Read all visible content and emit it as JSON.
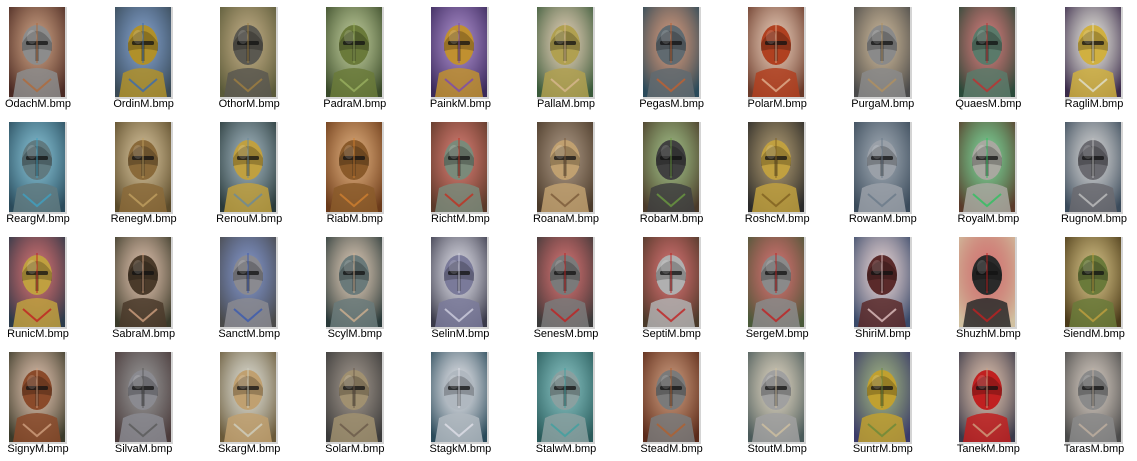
{
  "files": [
    {
      "name": "OdachM.bmp",
      "icon": "portrait-knight-horned-helm",
      "bg": "#4a2a24",
      "helm": "#8c8c8c",
      "accent": "#b06a3a"
    },
    {
      "name": "OrdinM.bmp",
      "icon": "portrait-blue-faced-warrior",
      "bg": "#3a4a55",
      "helm": "#b0902a",
      "accent": "#3a6ab0"
    },
    {
      "name": "OthorM.bmp",
      "icon": "portrait-dark-helm-knight",
      "bg": "#5a5a3a",
      "helm": "#5a5850",
      "accent": "#a08040"
    },
    {
      "name": "PadraM.bmp",
      "icon": "portrait-treant-druid",
      "bg": "#3a4a2a",
      "helm": "#6a7a3a",
      "accent": "#9ab060"
    },
    {
      "name": "PainkM.bmp",
      "icon": "portrait-gold-visor-knight",
      "bg": "#3a2a5a",
      "helm": "#c09030",
      "accent": "#7a4ab0"
    },
    {
      "name": "PallaM.bmp",
      "icon": "portrait-female-paladin",
      "bg": "#3a5a3a",
      "helm": "#b0a050",
      "accent": "#d8b890"
    },
    {
      "name": "PegasM.bmp",
      "icon": "portrait-pegasus-knight",
      "bg": "#2a4a5a",
      "helm": "#606a70",
      "accent": "#c06030"
    },
    {
      "name": "PolarM.bmp",
      "icon": "portrait-red-haired-warrior",
      "bg": "#6a3a2a",
      "helm": "#b04020",
      "accent": "#e0b090"
    },
    {
      "name": "PurgaM.bmp",
      "icon": "portrait-chainmail-knight",
      "bg": "#4a4a4a",
      "helm": "#8a8a8a",
      "accent": "#b09060"
    },
    {
      "name": "QuaesM.bmp",
      "icon": "portrait-green-helm-knight",
      "bg": "#2a4a3a",
      "helm": "#5a7a6a",
      "accent": "#c03030"
    },
    {
      "name": "RagliM.bmp",
      "icon": "portrait-golden-knight",
      "bg": "#3a2a4a",
      "helm": "#d0b040",
      "accent": "#e0e0d0"
    },
    {
      "name": "ReargM.bmp",
      "icon": "portrait-blue-armored-knight",
      "bg": "#2a4a5a",
      "helm": "#607a80",
      "accent": "#40a0c0"
    },
    {
      "name": "RenegM.bmp",
      "icon": "portrait-horned-beast",
      "bg": "#5a4a2a",
      "helm": "#8a6a3a",
      "accent": "#c0a060"
    },
    {
      "name": "RenouM.bmp",
      "icon": "portrait-crowned-king",
      "bg": "#2a3a3a",
      "helm": "#c0a040",
      "accent": "#6a8a9a"
    },
    {
      "name": "RiabM.bmp",
      "icon": "portrait-wooden-warrior",
      "bg": "#6a3a1a",
      "helm": "#8a5a2a",
      "accent": "#d08030"
    },
    {
      "name": "RichtM.bmp",
      "icon": "portrait-red-plumed-knight",
      "bg": "#5a3a2a",
      "helm": "#7a8a7a",
      "accent": "#c03020"
    },
    {
      "name": "RoanaM.bmp",
      "icon": "portrait-elf-archer",
      "bg": "#4a3a2a",
      "helm": "#c0a070",
      "accent": "#7a5a3a"
    },
    {
      "name": "RobarM.bmp",
      "icon": "portrait-green-goblin",
      "bg": "#4a3a2a",
      "helm": "#404040",
      "accent": "#6a9a40"
    },
    {
      "name": "RoshcM.bmp",
      "icon": "portrait-spiked-gold-helm",
      "bg": "#2a2a2a",
      "helm": "#c0a040",
      "accent": "#806020"
    },
    {
      "name": "RowanM.bmp",
      "icon": "portrait-steel-helm-knight",
      "bg": "#3a4a5a",
      "helm": "#9aa0a8",
      "accent": "#6a7a8a"
    },
    {
      "name": "RoyalM.bmp",
      "icon": "portrait-emerald-eyed-knight",
      "bg": "#5a3a2a",
      "helm": "#a8a8a0",
      "accent": "#30c060"
    },
    {
      "name": "RugnoM.bmp",
      "icon": "portrait-dwarf-king",
      "bg": "#3a4a5a",
      "helm": "#6a6a70",
      "accent": "#c0c0c0"
    },
    {
      "name": "RunicM.bmp",
      "icon": "portrait-runic-gold-helm",
      "bg": "#2a3a4a",
      "helm": "#c0a040",
      "accent": "#c02020"
    },
    {
      "name": "SabraM.bmp",
      "icon": "portrait-dark-haired-woman",
      "bg": "#3a3a2a",
      "helm": "#4a3a2a",
      "accent": "#d0a080"
    },
    {
      "name": "SanctM.bmp",
      "icon": "portrait-horned-barbarian",
      "bg": "#4a4a4a",
      "helm": "#8a8a90",
      "accent": "#3a5ab0"
    },
    {
      "name": "ScylM.bmp",
      "icon": "portrait-valkyrie",
      "bg": "#2a3a3a",
      "helm": "#6a7a7a",
      "accent": "#d0b090"
    },
    {
      "name": "SelinM.bmp",
      "icon": "portrait-hooded-moon-priestess",
      "bg": "#3a3a4a",
      "helm": "#7a7a9a",
      "accent": "#d0d0e0"
    },
    {
      "name": "SenesM.bmp",
      "icon": "portrait-red-crest-knight",
      "bg": "#3a3a3a",
      "helm": "#7a7a7a",
      "accent": "#c02020"
    },
    {
      "name": "SeptiM.bmp",
      "icon": "portrait-crowned-bucket-helm",
      "bg": "#4a3a2a",
      "helm": "#b0b0b0",
      "accent": "#c02020"
    },
    {
      "name": "SergeM.bmp",
      "icon": "portrait-crusader",
      "bg": "#4a5a3a",
      "helm": "#8a8a8a",
      "accent": "#c02020"
    },
    {
      "name": "ShiriM.bmp",
      "icon": "portrait-dark-elf-sorceress",
      "bg": "#3a4a6a",
      "helm": "#5a2a2a",
      "accent": "#e0c0c0"
    },
    {
      "name": "ShuzhM.bmp",
      "icon": "portrait-eastern-empress",
      "bg": "#d0c0a0",
      "helm": "#2a2a2a",
      "accent": "#c02020"
    },
    {
      "name": "SiendM.bmp",
      "icon": "portrait-green-hooded-ranger",
      "bg": "#4a3a1a",
      "helm": "#6a7a3a",
      "accent": "#c0a040"
    },
    {
      "name": "SignyM.bmp",
      "icon": "portrait-red-haired-shieldmaiden",
      "bg": "#3a3a2a",
      "helm": "#8a4a2a",
      "accent": "#d0a080"
    },
    {
      "name": "SilvaM.bmp",
      "icon": "portrait-silver-helm-knight",
      "bg": "#4a3a3a",
      "helm": "#8a8a90",
      "accent": "#5a5a5a"
    },
    {
      "name": "SkargM.bmp",
      "icon": "portrait-ram-horned-elder",
      "bg": "#6a5a3a",
      "helm": "#c0a070",
      "accent": "#d0d0c0"
    },
    {
      "name": "SolarM.bmp",
      "icon": "portrait-sun-helm-knight",
      "bg": "#3a3a3a",
      "helm": "#a09070",
      "accent": "#6a5a4a"
    },
    {
      "name": "StagkM.bmp",
      "icon": "portrait-stag-helm-knight",
      "bg": "#2a4a5a",
      "helm": "#b0b8c0",
      "accent": "#e0e0e8"
    },
    {
      "name": "StalwM.bmp",
      "icon": "portrait-teal-plate-knight",
      "bg": "#2a5a5a",
      "helm": "#8aa0a0",
      "accent": "#40a0a0"
    },
    {
      "name": "SteadM.bmp",
      "icon": "portrait-bronze-helm-knight",
      "bg": "#5a2a1a",
      "helm": "#7a7a7a",
      "accent": "#b06030"
    },
    {
      "name": "StoutM.bmp",
      "icon": "portrait-winged-helm-dwarf",
      "bg": "#4a5a5a",
      "helm": "#a0a0a0",
      "accent": "#d0c0a0"
    },
    {
      "name": "SuntrM.bmp",
      "icon": "portrait-sunflower-dryad",
      "bg": "#3a3a6a",
      "helm": "#c0a030",
      "accent": "#6a8a3a"
    },
    {
      "name": "TanekM.bmp",
      "icon": "portrait-red-hooded-assassin",
      "bg": "#3a3a4a",
      "helm": "#c02020",
      "accent": "#d0a080"
    },
    {
      "name": "TarasM.bmp",
      "icon": "portrait-grey-bearded-elder",
      "bg": "#4a4a4a",
      "helm": "#8a8a8a",
      "accent": "#c0b0a0"
    }
  ]
}
